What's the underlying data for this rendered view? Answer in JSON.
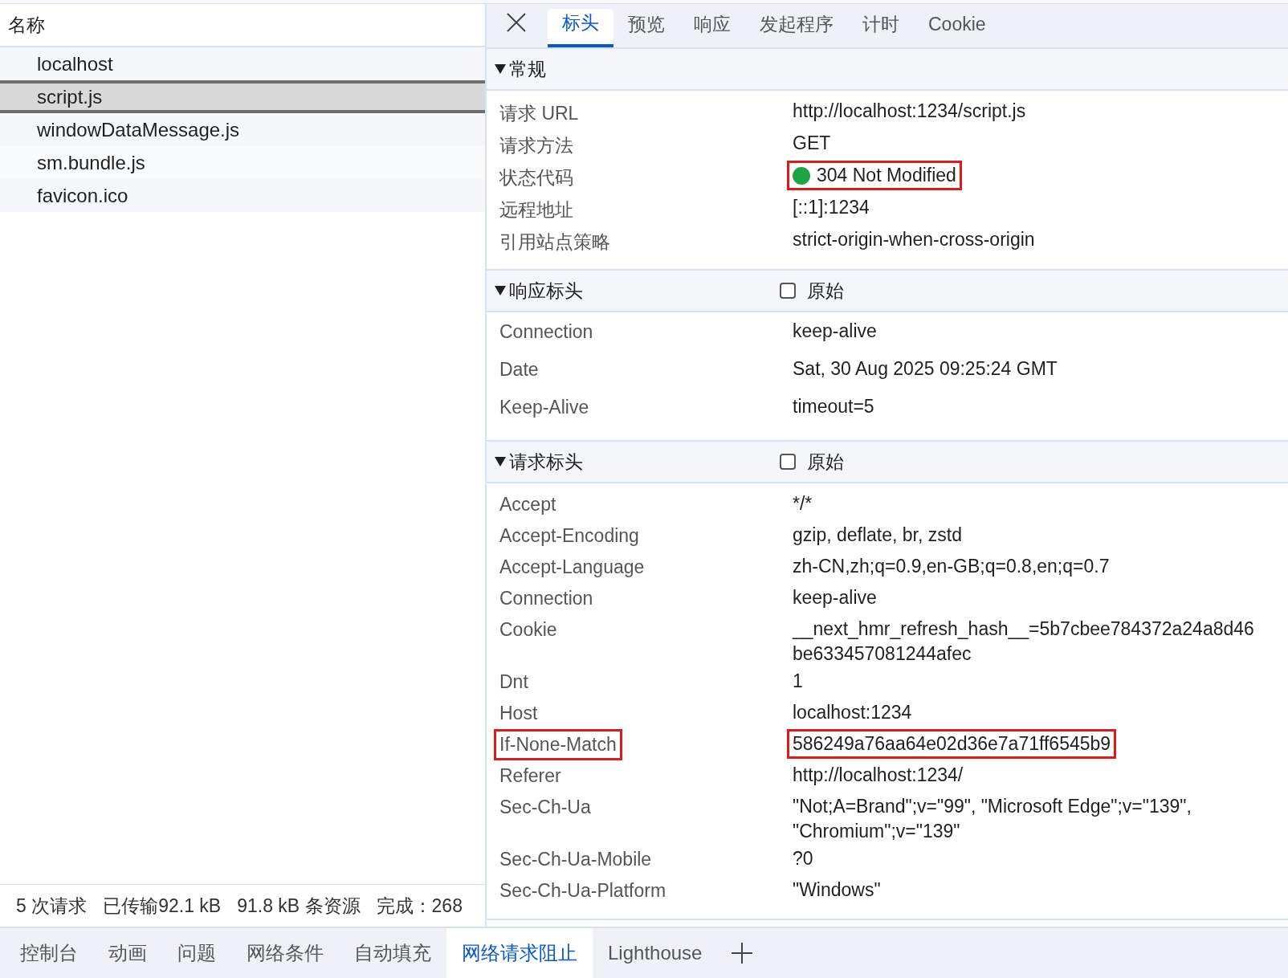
{
  "request_list": {
    "column_header": "名称",
    "items": [
      {
        "name": "localhost",
        "selected": false
      },
      {
        "name": "script.js",
        "selected": true
      },
      {
        "name": "windowDataMessage.js",
        "selected": false
      },
      {
        "name": "sm.bundle.js",
        "selected": false
      },
      {
        "name": "favicon.ico",
        "selected": false
      }
    ],
    "summary": [
      "5 次请求",
      "已传输92.1 kB",
      "91.8 kB 条资源",
      "完成：268"
    ]
  },
  "detail_tabs": [
    {
      "label": "标头",
      "selected": true
    },
    {
      "label": "预览",
      "selected": false
    },
    {
      "label": "响应",
      "selected": false
    },
    {
      "label": "发起程序",
      "selected": false
    },
    {
      "label": "计时",
      "selected": false
    },
    {
      "label": "Cookie",
      "selected": false
    }
  ],
  "sections": [
    {
      "title": "常规",
      "expanded": true,
      "kind": "general",
      "rows": [
        {
          "name": "请求 URL",
          "value": [
            "http://localhost:1234/script.js"
          ],
          "name_boxed": false,
          "value_boxed": false
        },
        {
          "name": "请求方法",
          "value": [
            "GET"
          ],
          "name_boxed": false,
          "value_boxed": false
        },
        {
          "name": "状态代码",
          "value": [
            "304 Not Modified"
          ],
          "color": "#1ea446",
          "name_boxed": false,
          "value_boxed": true
        },
        {
          "name": "远程地址",
          "value": [
            "[::1]:1234"
          ],
          "name_boxed": false,
          "value_boxed": false
        },
        {
          "name": "引用站点策略",
          "value": [
            "strict-origin-when-cross-origin"
          ],
          "name_boxed": false,
          "value_boxed": false
        }
      ]
    },
    {
      "title": "响应标头",
      "expanded": true,
      "kind": "response",
      "raw_label": "原始",
      "raw_checked": false,
      "rows": [
        {
          "name": "Connection",
          "value": [
            "keep-alive"
          ],
          "name_boxed": false,
          "value_boxed": false
        },
        {
          "name": "Date",
          "value": [
            "Sat, 30 Aug 2025 09:25:24 GMT"
          ],
          "name_boxed": false,
          "value_boxed": false
        },
        {
          "name": "Keep-Alive",
          "value": [
            "timeout=5"
          ],
          "name_boxed": false,
          "value_boxed": false
        }
      ]
    },
    {
      "title": "请求标头",
      "expanded": true,
      "kind": "request",
      "raw_label": "原始",
      "raw_checked": false,
      "rows": [
        {
          "name": "Accept",
          "value": [
            "*/*"
          ],
          "name_boxed": false,
          "value_boxed": false
        },
        {
          "name": "Accept-Encoding",
          "value": [
            "gzip, deflate, br, zstd"
          ],
          "name_boxed": false,
          "value_boxed": false
        },
        {
          "name": "Accept-Language",
          "value": [
            "zh-CN,zh;q=0.9,en-GB;q=0.8,en;q=0.7"
          ],
          "name_boxed": false,
          "value_boxed": false
        },
        {
          "name": "Connection",
          "value": [
            "keep-alive"
          ],
          "name_boxed": false,
          "value_boxed": false
        },
        {
          "name": "Cookie",
          "value": [
            "__next_hmr_refresh_hash__=5b7cbee784372a24a8d46",
            "be633457081244afec"
          ],
          "name_boxed": false,
          "value_boxed": false
        },
        {
          "name": "Dnt",
          "value": [
            "1"
          ],
          "name_boxed": false,
          "value_boxed": false
        },
        {
          "name": "Host",
          "value": [
            "localhost:1234"
          ],
          "name_boxed": false,
          "value_boxed": false
        },
        {
          "name": "If-None-Match",
          "value": [
            "586249a76aa64e02d36e7a71ff6545b9"
          ],
          "name_boxed": true,
          "value_boxed": true
        },
        {
          "name": "Referer",
          "value": [
            "http://localhost:1234/"
          ],
          "name_boxed": false,
          "value_boxed": false
        },
        {
          "name": "Sec-Ch-Ua",
          "value": [
            "\"Not;A=Brand\";v=\"99\", \"Microsoft Edge\";v=\"139\",",
            "\"Chromium\";v=\"139\""
          ],
          "name_boxed": false,
          "value_boxed": false
        },
        {
          "name": "Sec-Ch-Ua-Mobile",
          "value": [
            "?0"
          ],
          "name_boxed": false,
          "value_boxed": false
        },
        {
          "name": "Sec-Ch-Ua-Platform",
          "value": [
            "\"Windows\""
          ],
          "name_boxed": false,
          "value_boxed": false
        }
      ]
    }
  ],
  "drawer_tabs": [
    {
      "label": "控制台",
      "selected": false
    },
    {
      "label": "动画",
      "selected": false
    },
    {
      "label": "问题",
      "selected": false
    },
    {
      "label": "网络条件",
      "selected": false
    },
    {
      "label": "自动填充",
      "selected": false
    },
    {
      "label": "网络请求阻止",
      "selected": true
    },
    {
      "label": "Lighthouse",
      "selected": false
    }
  ]
}
